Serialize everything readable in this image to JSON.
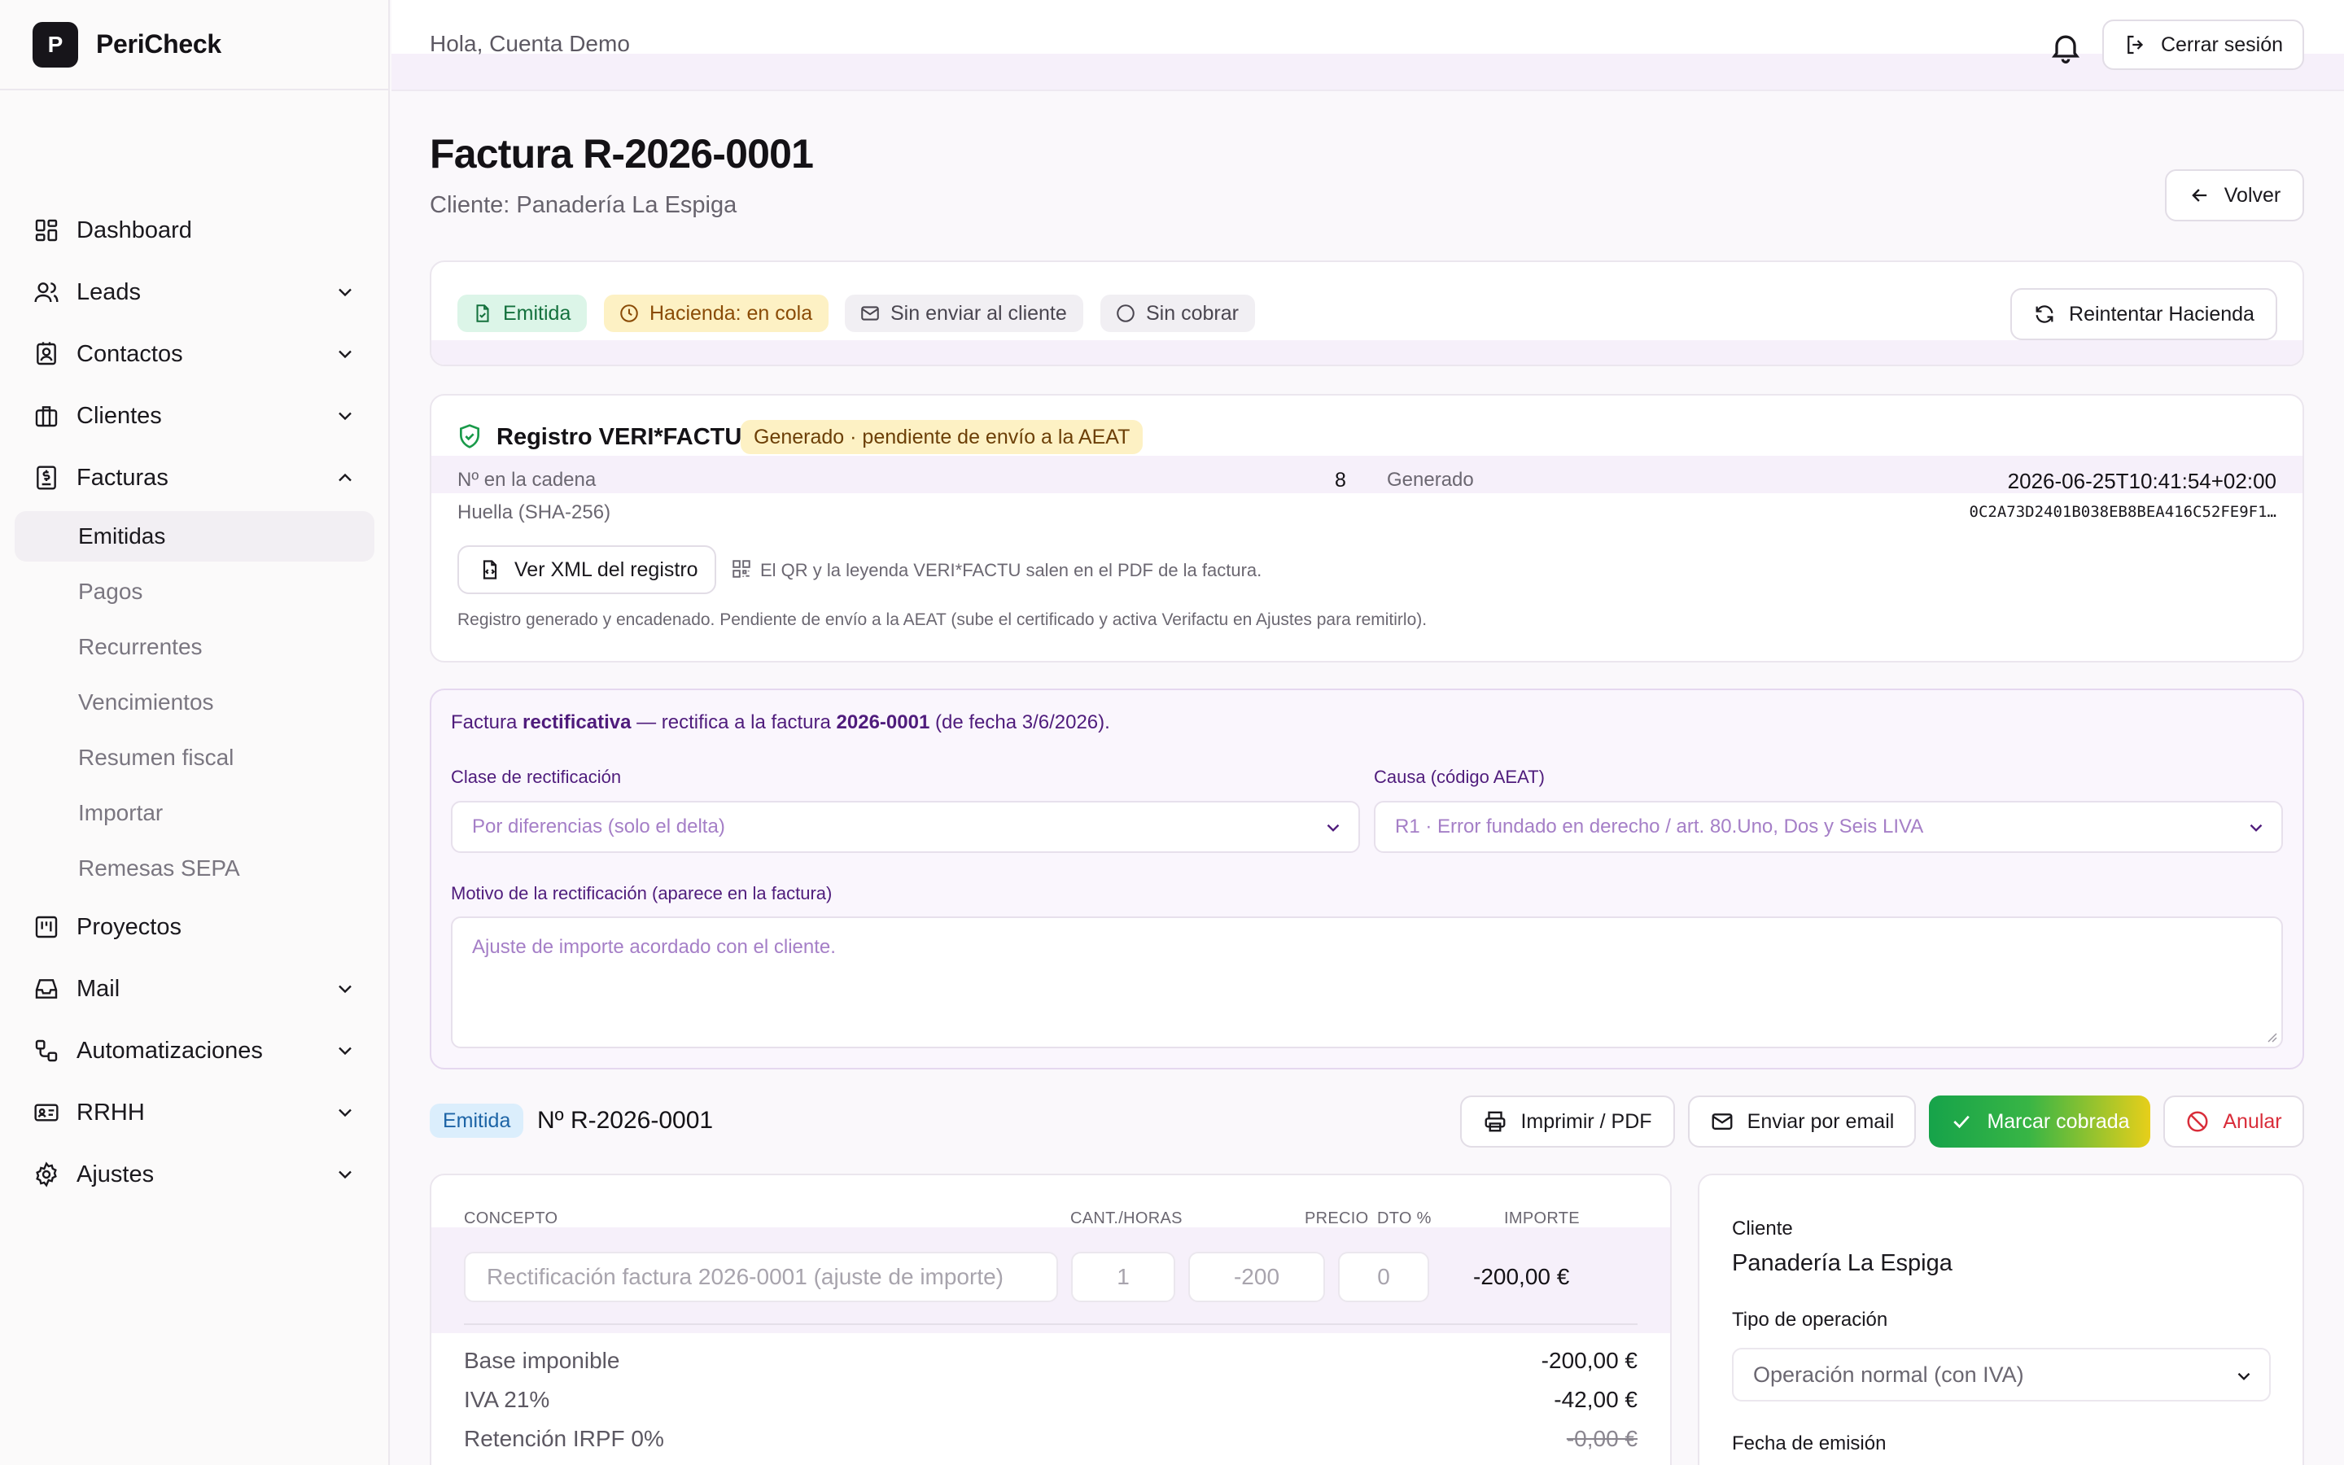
{
  "app": {
    "logo_letter": "P",
    "name": "PeriCheck"
  },
  "header": {
    "greeting": "Hola, Cuenta Demo",
    "logout_label": "Cerrar sesión"
  },
  "sidebar": {
    "items": [
      {
        "label": "Dashboard",
        "icon": "dashboard-icon"
      },
      {
        "label": "Leads",
        "icon": "users-icon"
      },
      {
        "label": "Contactos",
        "icon": "contact-icon"
      },
      {
        "label": "Clientes",
        "icon": "briefcase-icon"
      },
      {
        "label": "Facturas",
        "icon": "invoice-icon"
      },
      {
        "label": "Proyectos",
        "icon": "kanban-icon"
      },
      {
        "label": "Mail",
        "icon": "inbox-icon"
      },
      {
        "label": "Automatizaciones",
        "icon": "workflow-icon"
      },
      {
        "label": "RRHH",
        "icon": "id-card-icon"
      },
      {
        "label": "Ajustes",
        "icon": "gear-icon"
      }
    ],
    "facturas_sub": [
      "Emitidas",
      "Pagos",
      "Recurrentes",
      "Vencimientos",
      "Resumen fiscal",
      "Importar",
      "Remesas SEPA"
    ],
    "active_sub": "Emitidas"
  },
  "page": {
    "title": "Factura R-2026-0001",
    "subtitle": "Cliente: Panadería La Espiga",
    "back_label": "Volver"
  },
  "status": {
    "emitida": "Emitida",
    "hacienda": "Hacienda: en cola",
    "envio": "Sin enviar al cliente",
    "cobro": "Sin cobrar",
    "retry_label": "Reintentar Hacienda"
  },
  "verifactu": {
    "title": "Registro VERI*FACTU",
    "badge": "Generado · pendiente de envío a la AEAT",
    "chain_label": "Nº en la cadena",
    "chain_value": "8",
    "generated_label": "Generado",
    "generated_value": "2026-06-25T10:41:54+02:00",
    "hash_label": "Huella (SHA-256)",
    "hash_value": "0C2A73D2401B038EB8BEA416C52FE9F1…",
    "xml_button": "Ver XML del registro",
    "qr_note": "El QR y la leyenda VERI*FACTU salen en el PDF de la factura.",
    "footnote": "Registro generado y encadenado. Pendiente de envío a la AEAT (sube el certificado y activa Verifactu en Ajustes para remitirlo)."
  },
  "rectificativa": {
    "intro_1": "Factura ",
    "intro_bold_1": "rectificativa",
    "intro_2": " — rectifica a la factura ",
    "intro_bold_2": "2026-0001",
    "intro_3": " (de fecha 3/6/2026).",
    "clase_label": "Clase de rectificación",
    "clase_value": "Por diferencias (solo el delta)",
    "causa_label": "Causa (código AEAT)",
    "causa_value": "R1 · Error fundado en derecho / art. 80.Uno, Dos y Seis LIVA",
    "motivo_label": "Motivo de la rectificación (aparece en la factura)",
    "motivo_placeholder": "Ajuste de importe acordado con el cliente."
  },
  "invoice_bar": {
    "status": "Emitida",
    "number": "Nº R-2026-0001",
    "print": "Imprimir / PDF",
    "email": "Enviar por email",
    "paid": "Marcar cobrada",
    "cancel": "Anular"
  },
  "lines": {
    "headers": [
      "CONCEPTO",
      "CANT./HORAS",
      "PRECIO",
      "DTO %",
      "IMPORTE"
    ],
    "rows": [
      {
        "concepto": "Rectificación factura 2026-0001 (ajuste de importe)",
        "cantidad": "1",
        "precio": "-200",
        "dto": "0",
        "importe": "-200,00 €"
      }
    ]
  },
  "totals": [
    {
      "label": "Base imponible",
      "value": "-200,00 €"
    },
    {
      "label": "IVA 21%",
      "value": "-42,00 €"
    },
    {
      "label": "Retención IRPF 0%",
      "value": "-0,00 €"
    }
  ],
  "client_panel": {
    "cliente_label": "Cliente",
    "cliente_value": "Panadería La Espiga",
    "tipo_label": "Tipo de operación",
    "tipo_value": "Operación normal (con IVA)",
    "fecha_label": "Fecha de emisión"
  },
  "colors": {
    "accent_purple": "#4f1c7c",
    "success_green": "#1a9a4a",
    "danger_red": "#d92d3a",
    "warning_yellow": "#fdf1c4"
  }
}
